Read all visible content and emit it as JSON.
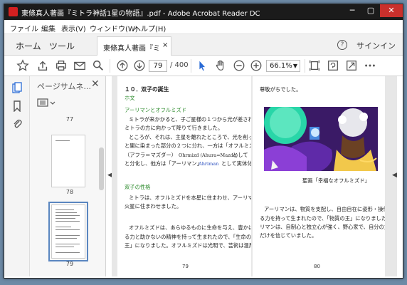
{
  "window": {
    "title": "東條真人著画『ミトラ神話1星の物語』.pdf - Adobe Acrobat Reader DC",
    "min": "─",
    "max": "▢",
    "close": "✕"
  },
  "menu": [
    "ファイル",
    "編集",
    "表示(V)",
    "ウィンドウ(W)",
    "ヘルプ(H)"
  ],
  "tabs": {
    "home": "ホーム",
    "tools": "ツール",
    "document": "東條真人著画『ミト...",
    "document_close": "×",
    "help": "?",
    "signin": "サインイン"
  },
  "toolbar": {
    "page_current": "79",
    "page_total": "/ 400",
    "zoom": "66.1%"
  },
  "panel": {
    "title": "ページサムネ...",
    "close": "✕",
    "thumbnails": [
      {
        "label": "77"
      },
      {
        "label": "78"
      },
      {
        "label": "79"
      }
    ]
  },
  "page_left": {
    "heading": "１０．双子の誕生",
    "sub1": "ホ文",
    "sub2": "アーリマンとオフルミズド",
    "lines1": [
      "ミトラが来かかると、子ご星様の１つから光が差され",
      "ミトラの方に向かって降りて行きました。",
      "ところが、それは、主星を離れたところで、光を削った部分",
      "と闇に染まった部分の２つに分れ、一方は「オフルミズド」",
      "（アフラ＝マズダー）",
      "と分化し、他方は「アーリマン」",
      "として実体化しました。"
    ],
    "ohrmazd": "Ohrmizd (Ahura=Mazda)",
    "ahriman": "Ahriman",
    "aside": "として",
    "sub3": "双子の性格",
    "lines2": [
      "ミトラは、オフルミズドを本星に住まわせ、アーリマンを",
      "火星に住まわせました。",
      "オフルミズドは、あらゆるものに生命を与え、豊かに富ませ",
      "る力と助かないの精神を持って生まれたので、「生命の",
      "王」になりました。オフルミズドは光明で、芸術は温厚で"
    ],
    "page_number": "79"
  },
  "page_right": {
    "top_line": "尊敬がちでした。",
    "caption": "聖画「幸福なオフルミズド」",
    "lines": [
      "アーリマンは、物質を支配し、自由自在に姿形・操作す",
      "る力を持って生まれたので、「物質の王」になりました。アー",
      "リマンは、自制心と独立心が強く、野心家で、自分の力",
      "だけを信じていました。"
    ],
    "page_number": "80"
  },
  "colors": {
    "titlebar": "#1b1b1b",
    "accent": "#2a6bd6",
    "heading_green": "#2b8a2b"
  }
}
